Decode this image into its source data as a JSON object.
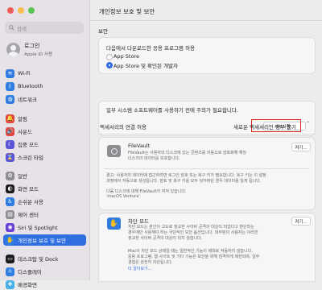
{
  "window": {
    "title": "개인정보 보호 및 보안"
  },
  "colors": {
    "accent": "#2f6fe0",
    "highlight": "#e1231f"
  },
  "sidebar": {
    "search_placeholder": "검색",
    "account": {
      "name": "로그인",
      "subtitle": "Apple ID 사용"
    },
    "items": [
      {
        "label": "Wi-Fi",
        "icon": "wifi-icon",
        "color": "#2f7de1"
      },
      {
        "label": "Bluetooth",
        "icon": "bluetooth-icon",
        "color": "#2f7de1"
      },
      {
        "label": "네트워크",
        "icon": "network-icon",
        "color": "#2f7de1"
      },
      {
        "label": "알림",
        "icon": "bell-icon",
        "color": "#e2463e"
      },
      {
        "label": "사운드",
        "icon": "speaker-icon",
        "color": "#e2463e"
      },
      {
        "label": "집중 모드",
        "icon": "moon-icon",
        "color": "#5a55d6"
      },
      {
        "label": "스크린 타임",
        "icon": "hourglass-icon",
        "color": "#5a55d6"
      },
      {
        "label": "일반",
        "icon": "gear-icon",
        "color": "#8e8e93"
      },
      {
        "label": "화면 모드",
        "icon": "appearance-icon",
        "color": "#1c1c1e"
      },
      {
        "label": "손쉬운 사용",
        "icon": "accessibility-icon",
        "color": "#2f7de1"
      },
      {
        "label": "제어 센터",
        "icon": "control-center-icon",
        "color": "#8e8e93"
      },
      {
        "label": "Siri 및 Spotlight",
        "icon": "siri-icon",
        "color": "#6a3fd6"
      },
      {
        "label": "개인정보 보호 및 보안",
        "icon": "hand-icon",
        "color": "#2f7de1"
      },
      {
        "label": "데스크탑 및 Dock",
        "icon": "dock-icon",
        "color": "#1c1c1e"
      },
      {
        "label": "디스플레이",
        "icon": "display-icon",
        "color": "#2f7de1"
      },
      {
        "label": "배경화면",
        "icon": "wallpaper-icon",
        "color": "#4ab0e8"
      }
    ],
    "selected_index": 12
  },
  "security": {
    "heading": "보안",
    "allow_label": "다음에서 다운로드한 응용 프로그램 허용",
    "options": [
      "App Store",
      "App Store 및 확인된 개발자"
    ],
    "selected_option": 1,
    "notice": "일부 시스템 소프트웨어를 사용하기 전에 주의가 필요합니다.",
    "details_button": "세부사항..."
  },
  "accessory": {
    "label": "액세서리의 연결 허용",
    "value": "새로운 액세서리인 경우 묻기",
    "chevron": "⌃"
  },
  "filevault": {
    "title": "FileVault",
    "desc_lines": [
      "FileVault는 사용자의 디스크에 있는 콘텐츠를 자동으로 암호화해 해당",
      "디스크의 데이터를 보호합니다."
    ],
    "button": "켜기...",
    "warn_lines": [
      "경고: 사용자의 데이터에 접근하려면 로그인 암호 또는 복구 키가 필요합니다. 복구 키는 이 설정",
      "과정에서 자동으로 생성됩니다. 암호 및 복구 키를 모두 잊어버린 경우 데이터를 잃게 됩니다."
    ],
    "disk_line": "다음 디스크에 대해 FileVault가 꺼져 있습니다.",
    "disk_name": "'macOS Ventura'"
  },
  "lockdown": {
    "title": "차단 모드",
    "button": "켜기...",
    "desc_lines": [
      "차단 모드는 본인이 고도로 정교한 사이버 공격의 대상이 되었다고 판단되는",
      "경우에만 사용해야 하는 극단적인 보안 옵션입니다. 대부분의 사용자는 이러한",
      "정교한 사이버 공격의 대상이 되지 않습니다."
    ],
    "detail_lines": [
      "Mac이 차단 모드 상태일 때는 일반적인 기능이 제대로 작동하지 않습니다.",
      "응용 프로그램, 웹 사이트 및 기타 기능은 보안을 위해 엄격하게 제한되며, 일부",
      "경험은 완전히 차단됩니다."
    ],
    "link": "더 알아보기..."
  }
}
